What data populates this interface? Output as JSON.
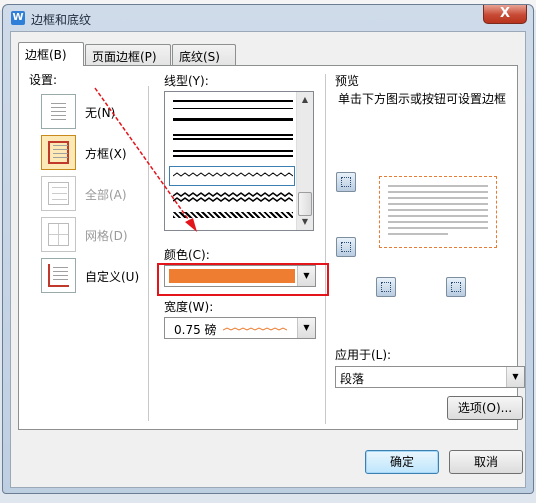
{
  "window": {
    "title": "边框和底纹",
    "close_label": "X"
  },
  "tabs": [
    {
      "label": "边框(B)",
      "active": true
    },
    {
      "label": "页面边框(P)",
      "active": false
    },
    {
      "label": "底纹(S)",
      "active": false
    }
  ],
  "settings": {
    "label": "设置:",
    "items": [
      {
        "label": "无(N)",
        "selected": false,
        "disabled": false
      },
      {
        "label": "方框(X)",
        "selected": true,
        "disabled": false
      },
      {
        "label": "全部(A)",
        "selected": false,
        "disabled": true
      },
      {
        "label": "网格(D)",
        "selected": false,
        "disabled": true
      },
      {
        "label": "自定义(U)",
        "selected": false,
        "disabled": false
      }
    ]
  },
  "line_style": {
    "label": "线型(Y):"
  },
  "color": {
    "label": "颜色(C):",
    "value": "#ee7d31"
  },
  "width": {
    "label": "宽度(W):",
    "value": "0.75 磅"
  },
  "preview": {
    "label": "预览",
    "hint": "单击下方图示或按钮可设置边框"
  },
  "apply_to": {
    "label": "应用于(L):",
    "value": "段落"
  },
  "buttons": {
    "options": "选项(O)...",
    "ok": "确定",
    "cancel": "取消"
  },
  "colors": {
    "accent_orange": "#ee7d31",
    "annotation_red": "#e3151b"
  }
}
